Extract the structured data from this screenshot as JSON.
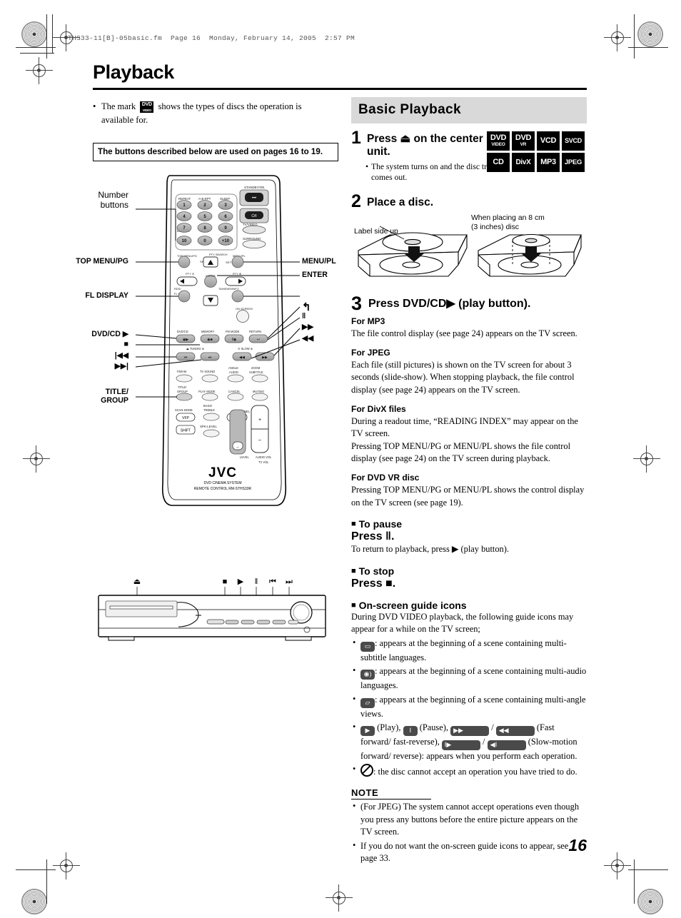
{
  "file_header": "THS33-11[B]-05basic.fm  Page 16  Monday, February 14, 2005  2:57 PM",
  "page_title": "Playback",
  "page_number": "16",
  "intro": {
    "bullet": "•",
    "text_before": "The mark",
    "mark_main": "DVD",
    "mark_sub": "VIDEO",
    "text_after": "shows the types of discs the operation is available for."
  },
  "buttons_box": "The buttons described below are used on pages 16 to 19.",
  "remote": {
    "brand": "JVC",
    "sub_brand_1": "DVD CINEMA SYSTEM",
    "sub_brand_2": "REMOTE CONTROL",
    "model": "RM-STHS33R",
    "callouts_left": [
      {
        "label": "Number\nbuttons",
        "style": "plain"
      },
      {
        "label": "TOP MENU/PG",
        "style": "bold"
      },
      {
        "label": "FL DISPLAY",
        "style": "bold"
      },
      {
        "label": "DVD/CD ▶",
        "style": "bold"
      },
      {
        "label": "■",
        "style": "sym"
      },
      {
        "label": "|◀◀",
        "style": "sym"
      },
      {
        "label": "▶▶|",
        "style": "sym"
      },
      {
        "label": "TITLE/\nGROUP",
        "style": "bold"
      }
    ],
    "callouts_right": [
      {
        "label": "MENU/PL",
        "style": "bold"
      },
      {
        "label": "ENTER",
        "style": "bold"
      },
      {
        "label": "↩",
        "style": "sym"
      },
      {
        "label": "‖",
        "style": "sym"
      },
      {
        "label": "▶▶",
        "style": "sym"
      },
      {
        "label": "◀◀",
        "style": "sym"
      }
    ],
    "keys": {
      "top_labels": [
        "REPEAT",
        "A-B RPT",
        "SLEEP"
      ],
      "numbers": [
        "1",
        "2",
        "3",
        "4",
        "5",
        "6",
        "7",
        "8",
        "9"
      ],
      "bottom_numbers": [
        "10",
        "0",
        "+10"
      ],
      "dimmer": "DIMMER",
      "standby_label": "STANDBY/ON",
      "standby_sym": "⏻/I",
      "tv_label": "TV",
      "tv_sym": "⏻/I",
      "tv_video": "TV/VIDEO",
      "surround": "SURROUND",
      "top_menu": "TOP MENU/PG",
      "set_up": "SET UP",
      "menu_pl": "MENU/PL",
      "setting": "SETTING",
      "pty_search": "PTY SEARCH",
      "pty_minus": "PTY ⊖",
      "pty_plus": "PTY ⊕",
      "rds": "RDS/",
      "fl_display": "FL DISPLAY",
      "tuning_info": "TA/NEWS/INFO",
      "on_screen": "ON SCREEN",
      "dvd_cd": "DVD/CD",
      "memory": "MEMORY",
      "fm_mode": "FM MODE",
      "return": "RETURN",
      "tuning": "TUNING",
      "slow": "SLOW",
      "fm_am": "FM/AM",
      "tv_sound": "TV SOUND",
      "angle_audio": "ANGLE\nAUDIO",
      "zoom_subtitle": "ZOOM\nSUBTITLE",
      "title_group": "TITLE/\nGROUP",
      "play_mode": "PLAY MODE",
      "cancel": "CANCEL",
      "muting": "MUTING",
      "scan_mode": "SCAN MODE",
      "vfp": "VFP",
      "bass_treble": "BASS/\nTREBLE",
      "tv_channel": "TV CHANNEL",
      "shift": "SHIFT",
      "spk_level": "SPK-LEVEL",
      "level": "LEVEL",
      "audio_vol": "AUDIO VOL\nTV VOL"
    }
  },
  "center_unit": {
    "symbols": [
      "⏏",
      "■",
      "▶",
      "‖",
      "⏮",
      "⏭"
    ]
  },
  "section": {
    "heading": "Basic Playback",
    "steps": [
      {
        "num": "1",
        "heading": "Press ⏏ on the center unit.",
        "sub_bullet": "•",
        "sub_text": "The system turns on and the disc tray comes out.",
        "discs_row1": [
          {
            "main": "DVD",
            "sub": "VIDEO"
          },
          {
            "main": "DVD",
            "sub": "VR"
          },
          {
            "main": "VCD",
            "sub": ""
          },
          {
            "main": "SVCD",
            "sub": ""
          }
        ],
        "discs_row2": [
          {
            "main": "CD",
            "sub": ""
          },
          {
            "main": "DivX",
            "sub": ""
          },
          {
            "main": "MP3",
            "sub": ""
          },
          {
            "main": "JPEG",
            "sub": ""
          }
        ]
      },
      {
        "num": "2",
        "heading": "Place a disc.",
        "caption_left": "Label side up",
        "caption_right": "When placing an 8 cm\n(3 inches) disc"
      },
      {
        "num": "3",
        "heading": "Press DVD/CD▶ (play button)."
      }
    ],
    "format_sections": [
      {
        "title": "For MP3",
        "body": "The file control display (see page 24) appears on the TV screen."
      },
      {
        "title": "For JPEG",
        "body": "Each file (still pictures) is shown on the TV screen for about 3 seconds (slide-show). When stopping playback, the file control display (see page 24) appears on the TV screen."
      },
      {
        "title": "For DivX files",
        "body": "During a readout time, “READING INDEX” may appear on the TV screen.\nPressing TOP MENU/PG or MENU/PL shows the file control display (see page 24) on the TV screen during playback."
      },
      {
        "title": "For DVD VR disc",
        "body": "Pressing TOP MENU/PG or MENU/PL shows the control display on the TV screen (see page 19)."
      }
    ],
    "pause_block": {
      "heading": "To pause",
      "press": "Press ‖.",
      "note": "To return to playback, press ▶ (play button)."
    },
    "stop_block": {
      "heading": "To stop",
      "press": "Press ■."
    },
    "guide_block": {
      "heading": "On-screen guide icons",
      "intro": "During DVD VIDEO playback, the following guide icons may appear for a while on the TV screen;",
      "items": [
        {
          "icon": "subtitle-icon",
          "glyph": "▭",
          "text": ": appears at the beginning of a scene containing multi-subtitle languages."
        },
        {
          "icon": "audio-icon",
          "glyph": "◉",
          "text": ": appears at the beginning of a scene containing multi-audio languages."
        },
        {
          "icon": "angle-icon",
          "glyph": "△",
          "text": ": appears at the beginning of a scene containing multi-angle views."
        },
        {
          "icon": "transport-icons",
          "glyph": "",
          "text": "(Play), (Pause), / (Fast forward/fast-reverse), / (Slow-motion forward/reverse): appears when you perform each operation."
        },
        {
          "icon": "prohibited-icon",
          "glyph": "⊘",
          "text": ": the disc cannot accept an operation you have tried to do."
        }
      ],
      "transport_labels": {
        "play": "(Play),",
        "pause": "(Pause),",
        "slash": "/",
        "ff": "(Fast forward/",
        "fr": "fast-reverse),",
        "slow": "(Slow-motion forward/",
        "slow2": "reverse): appears when you perform each operation."
      }
    },
    "note_block": {
      "heading": "NOTE",
      "items": [
        "(For JPEG) The system cannot accept operations even though you press any buttons before the entire picture appears on the TV screen.",
        "If you do not want the on-screen guide icons to appear, see page 33."
      ]
    }
  }
}
